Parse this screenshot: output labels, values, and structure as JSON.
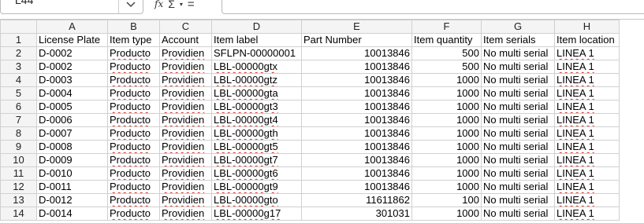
{
  "name_box": {
    "value": "L44"
  },
  "toolbar": {
    "fx_label": "fx",
    "sum_label": "Σ",
    "caret_label": "▾",
    "equals_label": "="
  },
  "columns": [
    "A",
    "B",
    "C",
    "D",
    "E",
    "F",
    "G",
    "H"
  ],
  "headers": [
    "License Plate",
    "Item type",
    "Account",
    "Item label",
    "Part Number",
    "Item quantity",
    "Item serials",
    "Item location"
  ],
  "rows": [
    {
      "row": "2",
      "cells": [
        "D-0002",
        "Producto",
        "Providien",
        "SFLPN-00000001",
        "10013846",
        "500",
        "No multi serial",
        "LINEA 1"
      ]
    },
    {
      "row": "3",
      "cells": [
        "D-0002",
        "Producto",
        "Providien",
        "LBL-00000gtx",
        "10013846",
        "500",
        "No multi serial",
        "LINEA 1"
      ]
    },
    {
      "row": "4",
      "cells": [
        "D-0003",
        "Producto",
        "Providien",
        "LBL-00000gtz",
        "10013846",
        "1000",
        "No multi serial",
        "LINEA 1"
      ]
    },
    {
      "row": "5",
      "cells": [
        "D-0004",
        "Producto",
        "Providien",
        "LBL-00000gta",
        "10013846",
        "1000",
        "No multi serial",
        "LINEA 1"
      ]
    },
    {
      "row": "6",
      "cells": [
        "D-0005",
        "Producto",
        "Providien",
        "LBL-00000gt3",
        "10013846",
        "1000",
        "No multi serial",
        "LINEA 1"
      ]
    },
    {
      "row": "7",
      "cells": [
        "D-0006",
        "Producto",
        "Providien",
        "LBL-00000gt4",
        "10013846",
        "1000",
        "No multi serial",
        "LINEA 1"
      ]
    },
    {
      "row": "8",
      "cells": [
        "D-0007",
        "Producto",
        "Providien",
        "LBL-00000gth",
        "10013846",
        "1000",
        "No multi serial",
        "LINEA 1"
      ]
    },
    {
      "row": "9",
      "cells": [
        "D-0008",
        "Producto",
        "Providien",
        "LBL-00000gt5",
        "10013846",
        "1000",
        "No multi serial",
        "LINEA 1"
      ]
    },
    {
      "row": "10",
      "cells": [
        "D-0009",
        "Producto",
        "Providien",
        "LBL-00000gt7",
        "10013846",
        "1000",
        "No multi serial",
        "LINEA 1"
      ]
    },
    {
      "row": "11",
      "cells": [
        "D-0010",
        "Producto",
        "Providien",
        "LBL-00000gt6",
        "10013846",
        "1000",
        "No multi serial",
        "LINEA 1"
      ]
    },
    {
      "row": "12",
      "cells": [
        "D-0011",
        "Producto",
        "Providien",
        "LBL-00000gt9",
        "10013846",
        "1000",
        "No multi serial",
        "LINEA 1"
      ]
    },
    {
      "row": "13",
      "cells": [
        "D-0012",
        "Producto",
        "Providien",
        "LBL-00000gto",
        "11611862",
        "100",
        "No multi serial",
        "LINEA 1"
      ]
    },
    {
      "row": "14",
      "cells": [
        "D-0014",
        "Producto",
        "Providien",
        "LBL-00000g17",
        "301031",
        "1000",
        "No multi serial",
        "LINEA 1"
      ]
    }
  ],
  "colors": {
    "header_bg": "#f4f4f4",
    "grid": "#d0d0d0",
    "spellcheck": "#d9352b"
  }
}
